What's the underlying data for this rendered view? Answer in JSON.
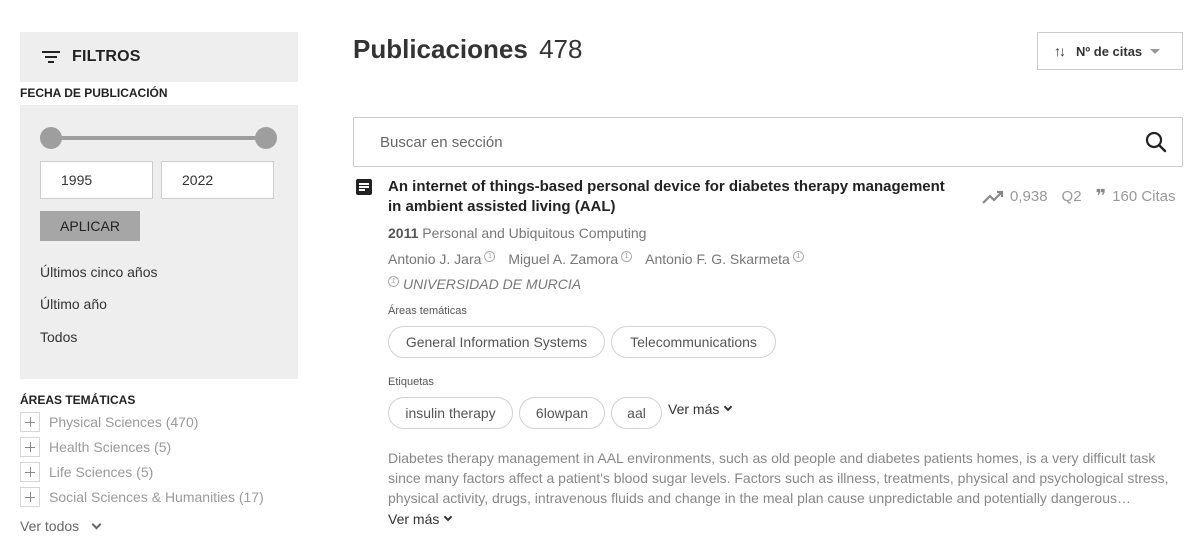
{
  "sidebar": {
    "filters_title": "FILTROS",
    "date_section": {
      "title": "FECHA DE PUBLICACIÓN",
      "range_from": "1995",
      "range_to": "2022",
      "apply_label": "APLICAR",
      "quick_options": [
        "Últimos cinco años",
        "Último año",
        "Todos"
      ]
    },
    "areas_section": {
      "title": "ÁREAS TEMÁTICAS",
      "items": [
        {
          "label": "Physical Sciences (470)"
        },
        {
          "label": "Health Sciences (5)"
        },
        {
          "label": "Life Sciences (5)"
        },
        {
          "label": "Social Sciences & Humanities (17)"
        }
      ],
      "see_all": "Ver todos"
    }
  },
  "main": {
    "title": "Publicaciones",
    "count": "478",
    "sort": {
      "label": "Nº de citas",
      "icon": "sort-arrows-icon"
    },
    "search": {
      "placeholder": "Buscar en sección"
    },
    "publication": {
      "title": "An internet of things-based personal device for diabetes therapy management in ambient assisted living (AAL)",
      "impact": "0,938",
      "quartile": "Q2",
      "citations": "160 Citas",
      "year": "2011",
      "journal": "Personal and Ubiquitous Computing",
      "authors": [
        {
          "name": "Antonio J. Jara",
          "ref": "1"
        },
        {
          "name": "Miguel A. Zamora",
          "ref": "1"
        },
        {
          "name": "Antonio F. G. Skarmeta",
          "ref": "1"
        }
      ],
      "institution": {
        "ref": "1",
        "name": "UNIVERSIDAD DE MURCIA"
      },
      "areas_label": "Áreas temáticas",
      "areas": [
        "General Information Systems",
        "Telecommunications"
      ],
      "tags_label": "Etiquetas",
      "tags": [
        "insulin therapy",
        "6lowpan",
        "aal"
      ],
      "tags_more": "Ver más",
      "abstract": "Diabetes therapy management in AAL environments, such as old people and diabetes patients homes, is a very difficult task since many factors affect a patient's blood sugar levels. Factors such as illness, treatments, physical and psychological stress, physical activity, drugs, intravenous fluids and change in the meal plan cause unpredictable and potentially dangerous fluctuations in blood glucose levels.",
      "abstract_more": "Ver más"
    }
  }
}
